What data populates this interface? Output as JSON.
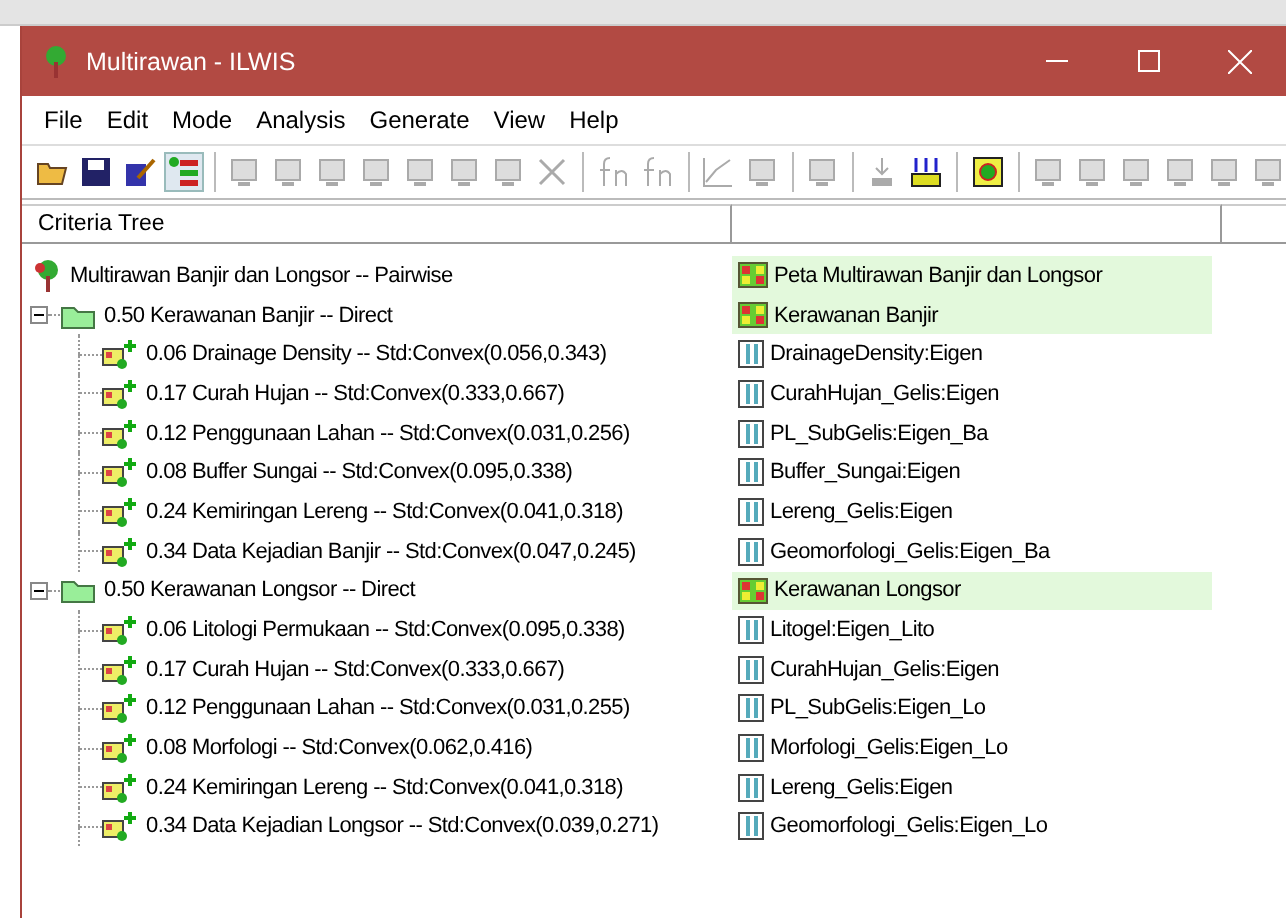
{
  "window": {
    "title": "Multirawan - ILWIS"
  },
  "menu": [
    "File",
    "Edit",
    "Mode",
    "Analysis",
    "Generate",
    "View",
    "Help"
  ],
  "columns": [
    "Criteria Tree"
  ],
  "tree": {
    "kind": "root",
    "label": "Multirawan Banjir dan Longsor -- Pairwise",
    "output": {
      "kind": "map",
      "name": "Peta Multirawan Banjir dan Longsor"
    },
    "children": [
      {
        "kind": "group",
        "expanded": true,
        "label": "0.50 Kerawanan Banjir -- Direct",
        "output": {
          "kind": "map",
          "name": "Kerawanan Banjir"
        },
        "children": [
          {
            "kind": "factor",
            "label": "0.06 Drainage Density -- Std:Convex(0.056,0.343)",
            "output": {
              "kind": "table",
              "name": "DrainageDensity:Eigen"
            }
          },
          {
            "kind": "factor",
            "label": "0.17 Curah Hujan -- Std:Convex(0.333,0.667)",
            "output": {
              "kind": "table",
              "name": "CurahHujan_Gelis:Eigen"
            }
          },
          {
            "kind": "factor",
            "label": "0.12 Penggunaan Lahan -- Std:Convex(0.031,0.256)",
            "output": {
              "kind": "table",
              "name": "PL_SubGelis:Eigen_Ba"
            }
          },
          {
            "kind": "factor",
            "label": "0.08 Buffer Sungai -- Std:Convex(0.095,0.338)",
            "output": {
              "kind": "table",
              "name": "Buffer_Sungai:Eigen"
            }
          },
          {
            "kind": "factor",
            "label": "0.24 Kemiringan Lereng -- Std:Convex(0.041,0.318)",
            "output": {
              "kind": "table",
              "name": "Lereng_Gelis:Eigen"
            }
          },
          {
            "kind": "factor",
            "label": "0.34 Data Kejadian Banjir -- Std:Convex(0.047,0.245)",
            "output": {
              "kind": "table",
              "name": "Geomorfologi_Gelis:Eigen_Ba"
            }
          }
        ]
      },
      {
        "kind": "group",
        "expanded": true,
        "label": "0.50 Kerawanan Longsor -- Direct",
        "output": {
          "kind": "map",
          "name": "Kerawanan Longsor"
        },
        "children": [
          {
            "kind": "factor",
            "label": "0.06 Litologi Permukaan -- Std:Convex(0.095,0.338)",
            "output": {
              "kind": "table",
              "name": "Litogel:Eigen_Lito"
            }
          },
          {
            "kind": "factor",
            "label": "0.17 Curah Hujan -- Std:Convex(0.333,0.667)",
            "output": {
              "kind": "table",
              "name": "CurahHujan_Gelis:Eigen"
            }
          },
          {
            "kind": "factor",
            "label": "0.12 Penggunaan Lahan -- Std:Convex(0.031,0.255)",
            "output": {
              "kind": "table",
              "name": "PL_SubGelis:Eigen_Lo"
            }
          },
          {
            "kind": "factor",
            "label": "0.08 Morfologi -- Std:Convex(0.062,0.416)",
            "output": {
              "kind": "table",
              "name": "Morfologi_Gelis:Eigen_Lo"
            }
          },
          {
            "kind": "factor",
            "label": "0.24 Kemiringan Lereng -- Std:Convex(0.041,0.318)",
            "output": {
              "kind": "table",
              "name": "Lereng_Gelis:Eigen"
            }
          },
          {
            "kind": "factor",
            "label": "0.34 Data Kejadian Longsor -- Std:Convex(0.039,0.271)",
            "output": {
              "kind": "table",
              "name": "Geomorfologi_Gelis:Eigen_Lo"
            }
          }
        ]
      }
    ]
  }
}
